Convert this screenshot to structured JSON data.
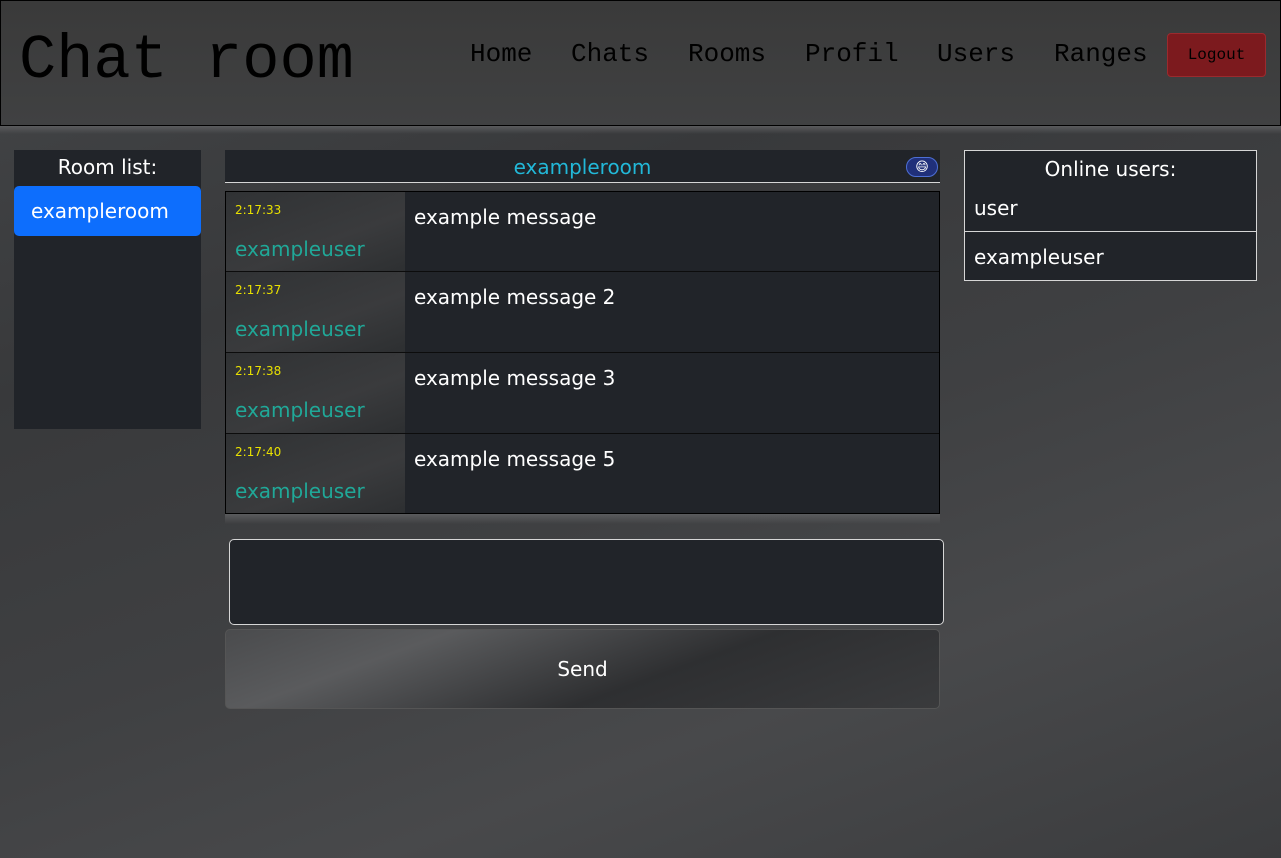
{
  "header": {
    "title": "Chat room",
    "nav": [
      "Home",
      "Chats",
      "Rooms",
      "Profil",
      "Users",
      "Ranges"
    ],
    "logout_label": "Logout"
  },
  "room_list": {
    "title": "Room list:",
    "rooms": [
      "exampleroom"
    ]
  },
  "chat": {
    "room_name": "exampleroom",
    "emoji_icon": "😄",
    "messages": [
      {
        "time": "2:17:33",
        "user": "exampleuser",
        "text": "example message"
      },
      {
        "time": "2:17:37",
        "user": "exampleuser",
        "text": "example message 2"
      },
      {
        "time": "2:17:38",
        "user": "exampleuser",
        "text": "example message 3"
      },
      {
        "time": "2:17:40",
        "user": "exampleuser",
        "text": "example message 5"
      }
    ],
    "input_value": "",
    "send_label": "Send"
  },
  "online_users": {
    "title": "Online users:",
    "users": [
      "user",
      "exampleuser"
    ]
  },
  "colors": {
    "accent": "#0d6efd",
    "room_title": "#22b8d8",
    "username": "#20a898",
    "timestamp": "#e8e000",
    "logout": "#7c1a1e"
  }
}
